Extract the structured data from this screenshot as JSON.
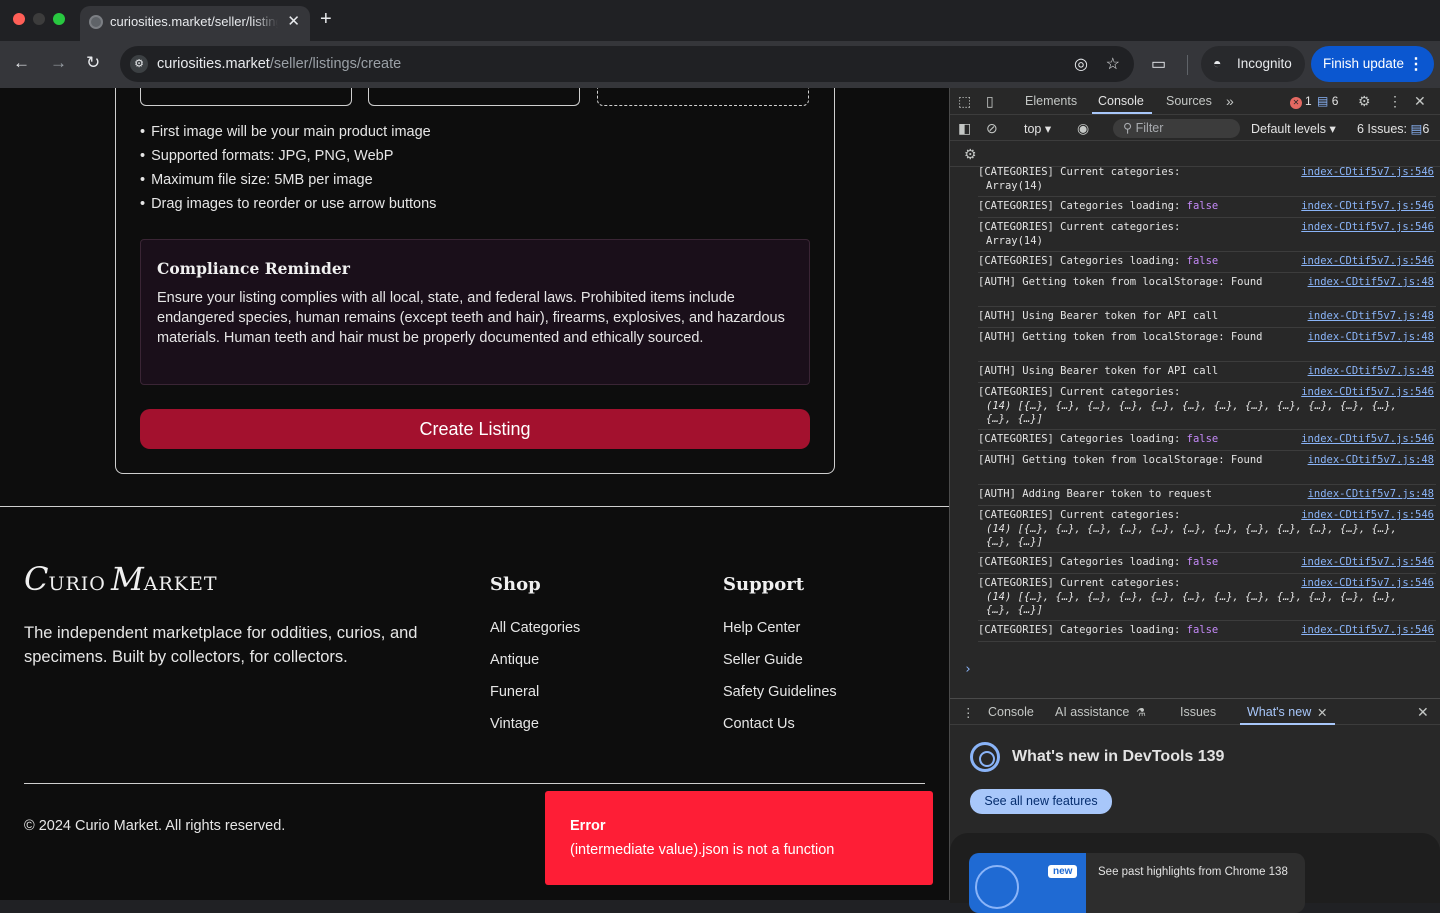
{
  "browser": {
    "tab_title": "curiosities.market/seller/listings/create",
    "url_host": "curiosities.market",
    "url_path": "/seller/listings/create",
    "incognito_label": "Incognito",
    "finish_update_label": "Finish update"
  },
  "page": {
    "image_hints": [
      "First image will be your main product image",
      "Supported formats: JPG, PNG, WebP",
      "Maximum file size: 5MB per image",
      "Drag images to reorder or use arrow buttons"
    ],
    "compliance": {
      "title": "Compliance Reminder",
      "body": "Ensure your listing complies with all local, state, and federal laws. Prohibited items include endangered species, human remains (except teeth and hair), firearms, explosives, and hazardous materials. Human teeth and hair must be properly documented and ethically sourced."
    },
    "create_button": "Create Listing"
  },
  "footer": {
    "logo_c": "C",
    "logo_urio": "URIO",
    "logo_m": "M",
    "logo_arket": "ARKET",
    "tagline": "The independent marketplace for oddities, curios, and specimens. Built by collectors, for collectors.",
    "shop_title": "Shop",
    "shop_links": [
      "All Categories",
      "Antique",
      "Funeral",
      "Vintage"
    ],
    "support_title": "Support",
    "support_links": [
      "Help Center",
      "Seller Guide",
      "Safety Guidelines",
      "Contact Us"
    ],
    "copyright": "© 2024 Curio Market. All rights reserved."
  },
  "error_toast": {
    "title": "Error",
    "message": "(intermediate value).json is not a function"
  },
  "devtools": {
    "tabs": [
      "Elements",
      "Console",
      "Sources"
    ],
    "error_count": "1",
    "message_count": "6",
    "context": "top",
    "filter_placeholder": "Filter",
    "levels": "Default levels",
    "issues_label": "6 Issues:",
    "issues_count": "6",
    "console_messages": [
      {
        "text": "[CATEGORIES] Current categories:",
        "detail": "Array(14)",
        "link": "index-CDtif5v7.js:546"
      },
      {
        "text": "[CATEGORIES] Categories loading: ",
        "flag": "false",
        "link": "index-CDtif5v7.js:546"
      },
      {
        "text": "[CATEGORIES] Current categories:",
        "detail": "Array(14)",
        "link": "index-CDtif5v7.js:546"
      },
      {
        "text": "[CATEGORIES] Categories loading: ",
        "flag": "false",
        "link": "index-CDtif5v7.js:546"
      },
      {
        "text": "[AUTH] Getting token from localStorage: Found",
        "link": "index-CDtif5v7.js:48"
      },
      {
        "text": "[AUTH] Using Bearer token for API call",
        "link": "index-CDtif5v7.js:48"
      },
      {
        "text": "[AUTH] Getting token from localStorage: Found",
        "link": "index-CDtif5v7.js:48"
      },
      {
        "text": "[AUTH] Using Bearer token for API call",
        "link": "index-CDtif5v7.js:48"
      },
      {
        "text": "[CATEGORIES] Current categories:",
        "detail": "(14) [{…}, {…}, {…}, {…}, {…}, {…}, {…}, {…}, {…}, {…}, {…}, {…}, {…}, {…}]",
        "link": "index-CDtif5v7.js:546"
      },
      {
        "text": "[CATEGORIES] Categories loading: ",
        "flag": "false",
        "link": "index-CDtif5v7.js:546"
      },
      {
        "text": "[AUTH] Getting token from localStorage: Found",
        "link": "index-CDtif5v7.js:48"
      },
      {
        "text": "[AUTH] Adding Bearer token to request",
        "link": "index-CDtif5v7.js:48"
      },
      {
        "text": "[CATEGORIES] Current categories:",
        "detail": "(14) [{…}, {…}, {…}, {…}, {…}, {…}, {…}, {…}, {…}, {…}, {…}, {…}, {…}, {…}]",
        "link": "index-CDtif5v7.js:546"
      },
      {
        "text": "[CATEGORIES] Categories loading: ",
        "flag": "false",
        "link": "index-CDtif5v7.js:546"
      },
      {
        "text": "[CATEGORIES] Current categories:",
        "detail": "(14) [{…}, {…}, {…}, {…}, {…}, {…}, {…}, {…}, {…}, {…}, {…}, {…}, {…}, {…}]",
        "link": "index-CDtif5v7.js:546"
      },
      {
        "text": "[CATEGORIES] Categories loading: ",
        "flag": "false",
        "link": "index-CDtif5v7.js:546"
      }
    ],
    "drawer_tabs": [
      "Console",
      "AI assistance",
      "Issues",
      "What's new"
    ],
    "whats_new_title": "What's new in DevTools 139",
    "see_features": "See all new features",
    "new_badge": "new",
    "highlight_text": "See past highlights from Chrome 138"
  }
}
